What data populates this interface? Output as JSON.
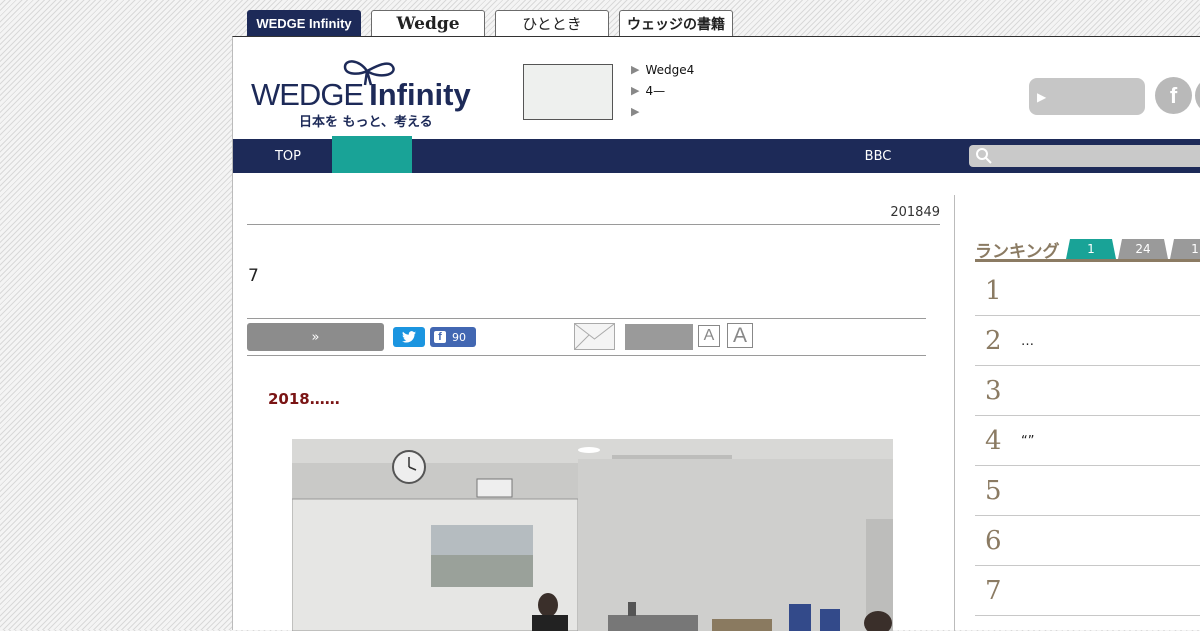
{
  "site_tabs": [
    {
      "label": "WEDGE Infinity"
    },
    {
      "label": "Wedge"
    },
    {
      "label": "ひととき"
    },
    {
      "label": "ウェッジの書籍"
    }
  ],
  "logo": {
    "word1": "WEDGE",
    "word2": "Infinity",
    "tagline": "日本を もっと、考える"
  },
  "header_links": [
    "Wedge4",
    "4—",
    ""
  ],
  "social": {
    "facebook": "f"
  },
  "nav": {
    "top": "TOP",
    "bbc": "BBC"
  },
  "article": {
    "date": "201849",
    "title": "7",
    "more_button": "»",
    "fb_count": "90",
    "font_small": "A",
    "font_large": "A",
    "lead": "2018……"
  },
  "ranking": {
    "title": "ランキング",
    "tabs": [
      "1",
      "24",
      "1"
    ],
    "items": [
      {
        "num": "1",
        "title": ""
      },
      {
        "num": "2",
        "title": "…"
      },
      {
        "num": "3",
        "title": ""
      },
      {
        "num": "4",
        "title": "“”"
      },
      {
        "num": "5",
        "title": ""
      },
      {
        "num": "6",
        "title": ""
      },
      {
        "num": "7",
        "title": ""
      }
    ]
  },
  "colors": {
    "navy": "#1d2a58",
    "teal": "#19a397",
    "ranking_brown": "#8b7b63",
    "lead_red": "#7a1414"
  }
}
